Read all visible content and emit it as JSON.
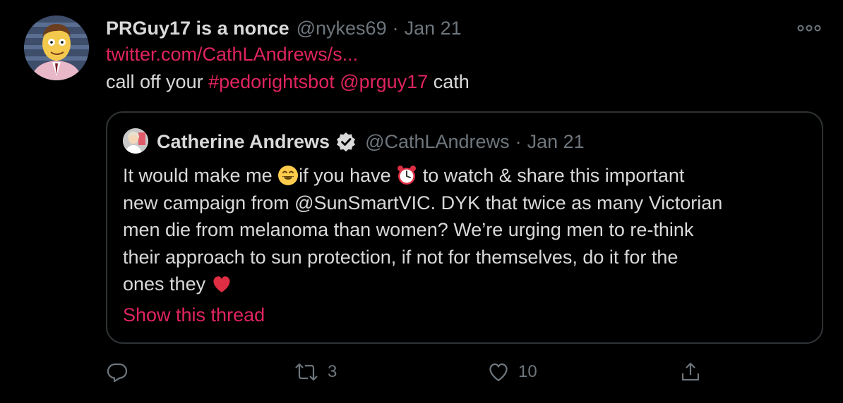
{
  "tweet": {
    "display_name": "PRGuy17 is a nonce",
    "handle": "@nykes69",
    "separator": "·",
    "date": "Jan 21",
    "link": "twitter.com/CathLAndrews/s...",
    "text_prefix": "call off your ",
    "hashtag": "#pedorightsbot",
    "mention": "@prguy17",
    "text_suffix": " cath"
  },
  "quote": {
    "display_name": "Catherine Andrews",
    "handle": "@CathLAndrews",
    "separator": "·",
    "date": "Jan 21",
    "line1_a": "It would make me ",
    "line1_b": "if you have ",
    "line1_c": " to watch & share this important",
    "line2": "new campaign from @SunSmartVIC.  DYK that twice as many Victorian",
    "line3": "men die from melanoma than women? We’re urging men to re-think",
    "line4": "their approach to sun protection, if not for themselves, do it for the",
    "line5": "ones they ",
    "show_thread": "Show this thread"
  },
  "actions": {
    "reply_count": "",
    "retweet_count": "3",
    "like_count": "10"
  },
  "icons": {
    "avatar": "cartoon-avatar",
    "more": "more-icon",
    "verified": "verified-badge-icon",
    "reply": "reply-icon",
    "retweet": "retweet-icon",
    "like": "heart-icon",
    "share": "share-icon",
    "emoji_grin": "grinning-face-emoji",
    "emoji_clock": "alarm-clock-emoji",
    "emoji_heart": "red-heart-emoji"
  },
  "colors": {
    "background": "#000000",
    "text": "#d9d9d9",
    "muted": "#6e767d",
    "accent": "#e0245e",
    "border": "#2f3336"
  }
}
